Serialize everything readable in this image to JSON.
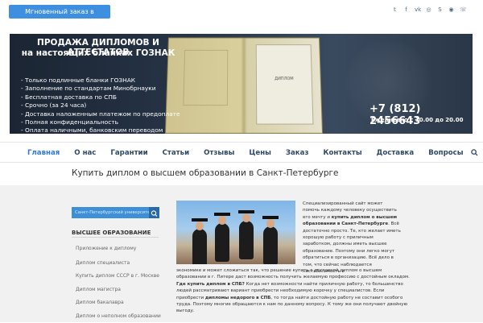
{
  "topbar": {
    "whatsapp_button": "Мгновенный заказ в WhatsApp!",
    "social_icons": [
      "twitter-icon",
      "facebook-icon",
      "vk-icon",
      "instagram-icon",
      "skype-icon",
      "whatsapp-icon",
      "phone-icon"
    ]
  },
  "banner": {
    "title_line1": "ПРОДАЖА ДИПЛОМОВ И АТТЕСТАТОВ",
    "title_line2": "на настоящих бланках ГОЗНАК",
    "features": [
      "- Только подлинные бланки ГОЗНАК",
      "- Заполнение по стандартам Минобрнауки",
      "- Бесплатная доставка по СПБ",
      "- Срочно (за 24 часа)",
      "- Доставка наложенным платежом по предоплате",
      "- Полная конфиденциальность",
      "- Оплата наличными, банковским переводом"
    ],
    "diploma_word": "ДИПЛОМ",
    "phone": "+7 (812) 2456643",
    "hours": "Ежедневно с 10.00 до 20.00"
  },
  "nav": {
    "items": [
      {
        "label": "Главная",
        "active": true
      },
      {
        "label": "О нас",
        "active": false
      },
      {
        "label": "Гарантии",
        "active": false
      },
      {
        "label": "Статьи",
        "active": false
      },
      {
        "label": "Отзывы",
        "active": false
      },
      {
        "label": "Цены",
        "active": false
      },
      {
        "label": "Заказ",
        "active": false
      },
      {
        "label": "Контакты",
        "active": false
      },
      {
        "label": "Доставка",
        "active": false
      },
      {
        "label": "Вопросы",
        "active": false
      }
    ]
  },
  "page": {
    "title": "Купить диплом о высшем образовании в Санкт-Петербурге"
  },
  "sidebar": {
    "search_value": "Санкт-Петербургский университет",
    "heading": "ВЫСШЕЕ ОБРАЗОВАНИЕ",
    "items": [
      "Приложение к диплому",
      "Диплом специалиста",
      "Купить диплом СССР в г. Москве",
      "Диплом магистра",
      "Диплом бакалавра",
      "Диплом о неполном образовании"
    ]
  },
  "content": {
    "right_p1": "Специализированный сайт может помочь каждому человеку осуществить его мечту и",
    "right_b1": "купить диплом о высшем образовании в Санкт-Петербурге",
    "right_p2": ". Всё достаточно просто. Те, кто желает иметь хорошую работу с приличным заработком, должны иметь высшее образование. Поэтому они легко могут обратиться в организацию. Всё дело в том, что сейчас наблюдается нестабильность в",
    "full_p1": "экономике и может сложиться так, что решение купить с доставкой диплом о высшем образовании в г. Питере даст возможность получить желаемую профессию с достойным окладом.",
    "full_b1": "Где купить диплом в СПБ?",
    "full_p2": "Когда нет возможности найти приличную работу, то большинство людей рассматривают вариант приобрести необходимую корочку у специалистов. Если приобрести",
    "full_b2": "дипломы недорого в СПБ",
    "full_p3": ", то тогда найти достойную работу не составит особого труда. Поэтому многие обращаются к нам по данному вопросу. К тому же они получают двойную выгоду."
  }
}
